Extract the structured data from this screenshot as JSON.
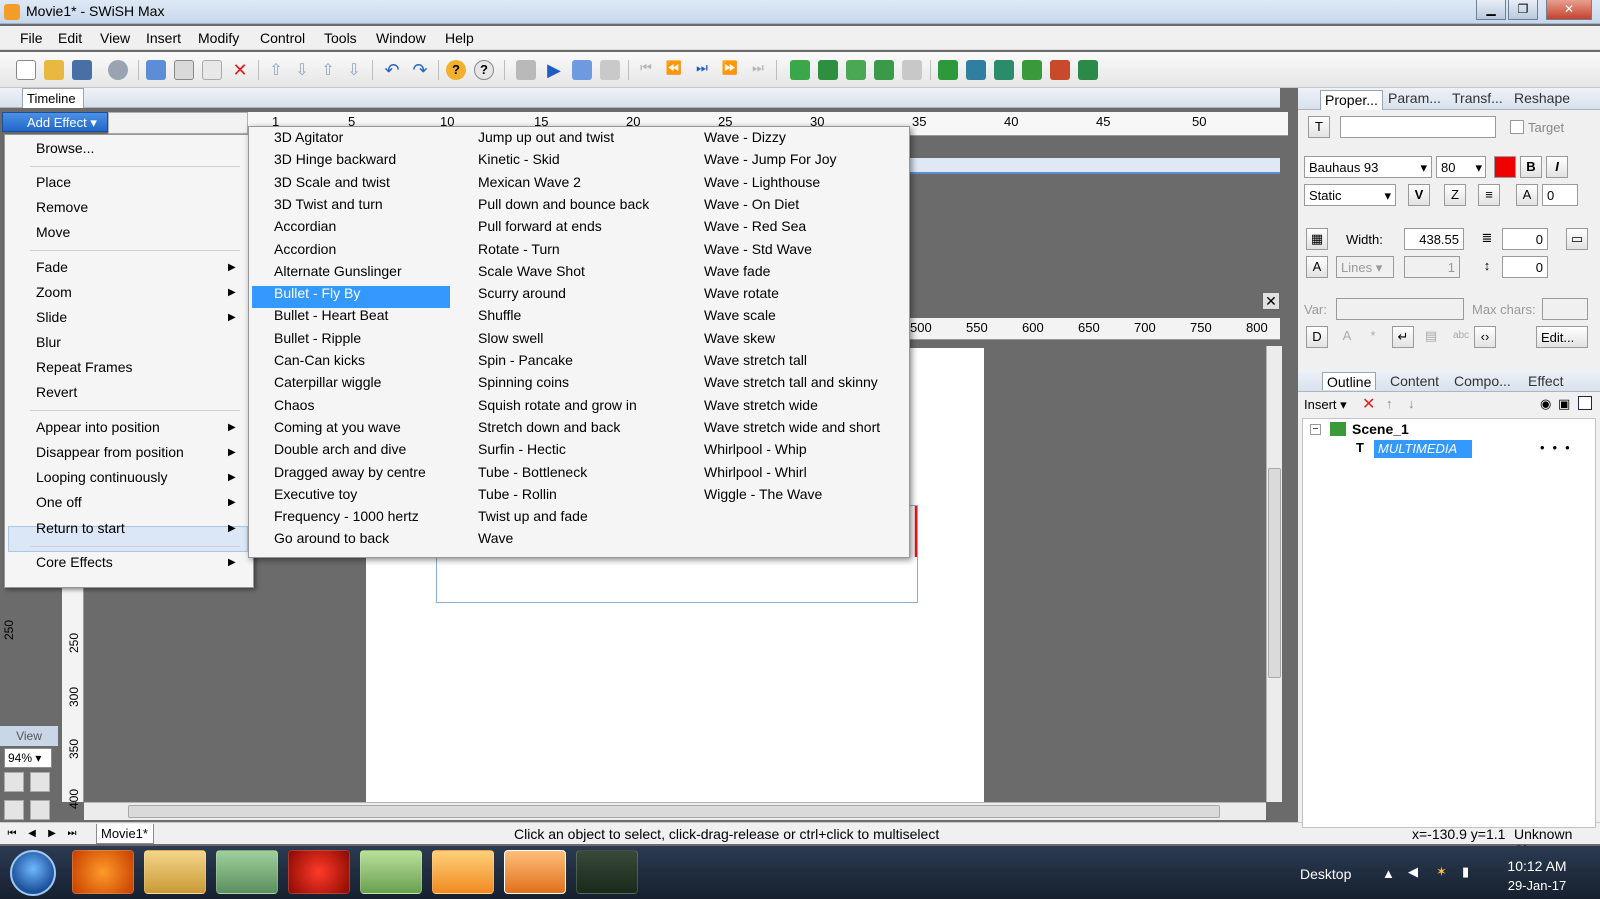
{
  "window": {
    "title": "Movie1* - SWiSH Max",
    "min_label": "▁",
    "max_label": "❐",
    "close_label": "✕"
  },
  "menubar": [
    "File",
    "Edit",
    "View",
    "Insert",
    "Modify",
    "Control",
    "Tools",
    "Window",
    "Help"
  ],
  "timeline": {
    "tab_label": "Timeline",
    "add_effect_label": "Add Effect",
    "ruler_ticks": [
      "1",
      "5",
      "10",
      "15",
      "20",
      "25",
      "30",
      "35",
      "40",
      "45",
      "50"
    ]
  },
  "effect_menu": {
    "items": [
      {
        "label": "Browse...",
        "submenu": false
      },
      {
        "label": "Place",
        "submenu": false
      },
      {
        "label": "Remove",
        "submenu": false
      },
      {
        "label": "Move",
        "submenu": false
      },
      {
        "label": "Fade",
        "submenu": true
      },
      {
        "label": "Zoom",
        "submenu": true
      },
      {
        "label": "Slide",
        "submenu": true
      },
      {
        "label": "Blur",
        "submenu": false
      },
      {
        "label": "Repeat Frames",
        "submenu": false
      },
      {
        "label": "Revert",
        "submenu": false
      },
      {
        "label": "Appear into position",
        "submenu": true
      },
      {
        "label": "Disappear from position",
        "submenu": true
      },
      {
        "label": "Looping continuously",
        "submenu": true
      },
      {
        "label": "One off",
        "submenu": true
      },
      {
        "label": "Return to start",
        "submenu": true
      },
      {
        "label": "Core Effects",
        "submenu": true
      }
    ],
    "highlighted": "Return to start"
  },
  "submenu": {
    "col1": [
      "3D Agitator",
      "3D Hinge backward",
      "3D Scale and twist",
      "3D Twist and turn",
      "Accordian",
      "Accordion",
      "Alternate Gunslinger",
      "Bullet - Fly By",
      "Bullet - Heart Beat",
      "Bullet - Ripple",
      "Can-Can kicks",
      "Caterpillar wiggle",
      "Chaos",
      "Coming at you wave",
      "Double arch and dive",
      "Dragged away by centre",
      "Executive toy",
      "Frequency - 1000 hertz",
      "Go around to back"
    ],
    "col2": [
      "Jump up out and twist",
      "Kinetic - Skid",
      "Mexican Wave 2",
      "Pull down and bounce back",
      "Pull forward at ends",
      "Rotate - Turn",
      "Scale Wave Shot",
      "Scurry around",
      "Shuffle",
      "Slow swell",
      "Spin - Pancake",
      "Spinning coins",
      "Squish rotate and grow in",
      "Stretch down and back",
      "Surfin - Hectic",
      "Tube - Bottleneck",
      "Tube - Rollin",
      "Twist up and fade",
      "Wave"
    ],
    "col3": [
      "Wave - Dizzy",
      "Wave - Jump For Joy",
      "Wave - Lighthouse",
      "Wave - On Diet",
      "Wave - Red Sea",
      "Wave - Std Wave",
      "Wave fade",
      "Wave rotate",
      "Wave scale",
      "Wave skew",
      "Wave stretch tall",
      "Wave stretch tall and skinny",
      "Wave stretch wide",
      "Wave stretch wide and short",
      "Whirlpool - Whip",
      "Whirlpool - Whirl",
      "Wiggle - The Wave"
    ],
    "selected": "Bullet - Fly By"
  },
  "stage": {
    "ruler_ticks": [
      "500",
      "550",
      "600",
      "650",
      "700",
      "750",
      "800"
    ],
    "left_ticks": [
      "250",
      "300",
      "350",
      "400"
    ],
    "text_object": "MULTIMEDIA",
    "text_color": "#e8121c"
  },
  "view_tools": {
    "label": "View",
    "zoom": "94%"
  },
  "bottom": {
    "movie_tab": "Movie1*",
    "status_message": "Click an object to select, click-drag-release or ctrl+click to multiselect",
    "coords": "x=-130.9 y=1.1",
    "size_text": "Unknown Size"
  },
  "properties": {
    "tabs": [
      "Proper...",
      "Param...",
      "Transf...",
      "Reshape"
    ],
    "target_label": "Target",
    "font_name": "Bauhaus 93",
    "font_size": "80",
    "bold_label": "B",
    "italic_label": "I",
    "text_type": "Static",
    "kerning": "0",
    "width_label": "Width:",
    "width_value": "438.55",
    "indent_value": "0",
    "lines_label": "Lines",
    "lines_value": "1",
    "spacing_value": "0",
    "var_label": "Var:",
    "maxchars_label": "Max chars:",
    "edit_label": "Edit..."
  },
  "outline": {
    "tabs": [
      "Outline",
      "Content",
      "Compo...",
      "Effect"
    ],
    "insert_label": "Insert",
    "scene_label": "Scene_1",
    "object_label": "MULTIMEDIA"
  },
  "taskbar": {
    "desktop_label": "Desktop",
    "time": "10:12 AM",
    "date": "29-Jan-17"
  }
}
